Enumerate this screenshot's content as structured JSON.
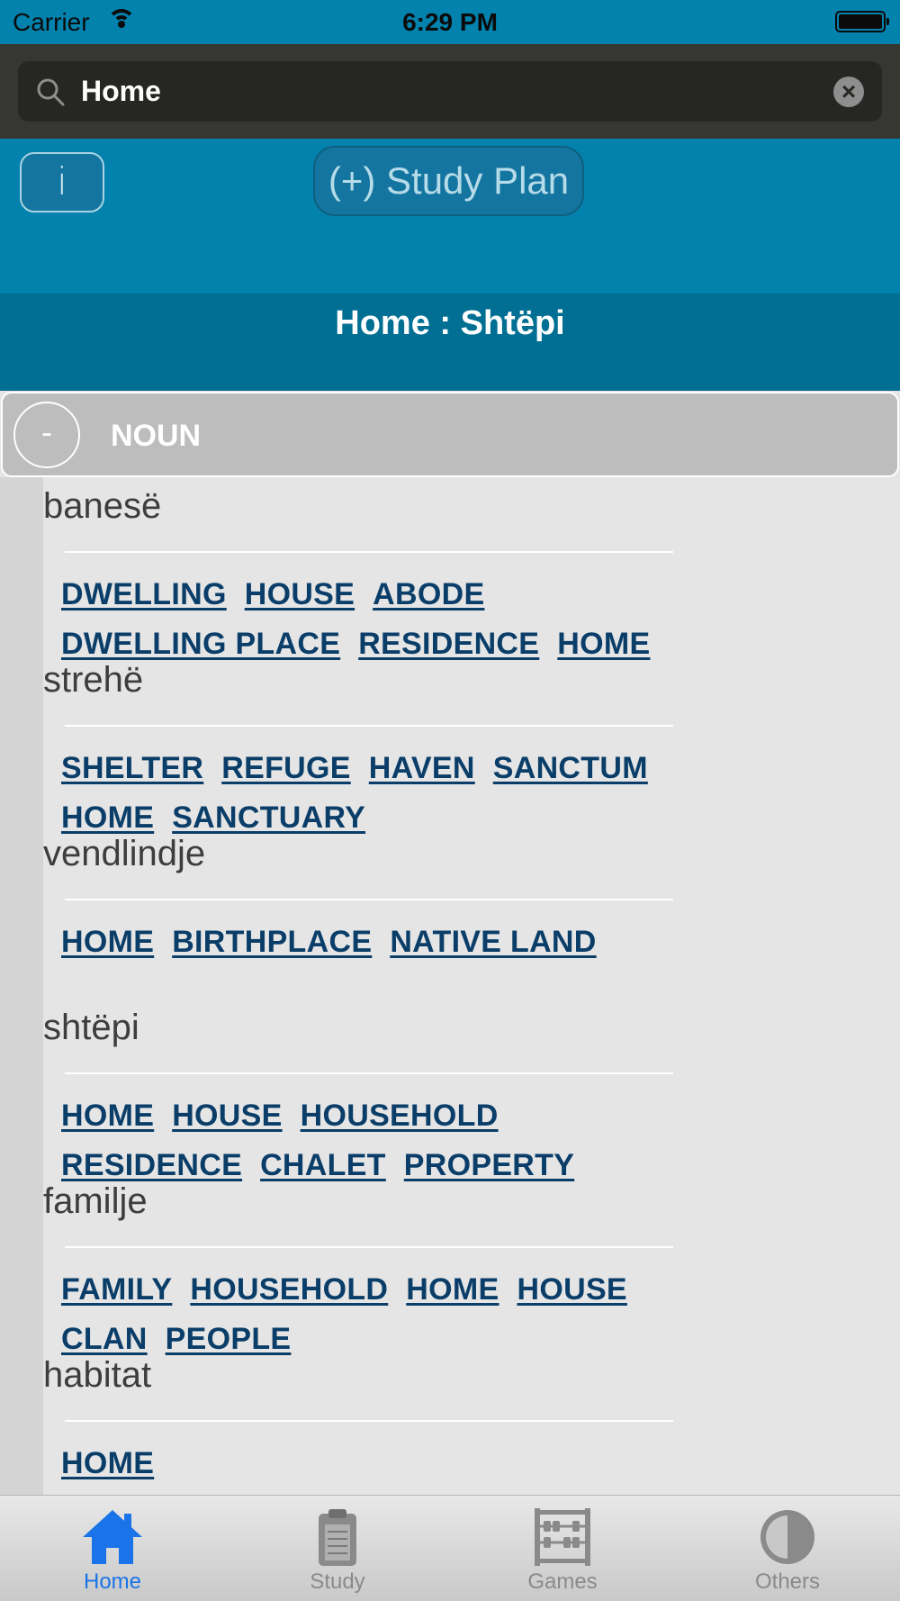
{
  "status_bar": {
    "carrier": "Carrier",
    "time": "6:29 PM"
  },
  "search": {
    "value": "Home",
    "placeholder": ""
  },
  "toolbar": {
    "info_label": "i",
    "study_plan_label": "(+) Study Plan"
  },
  "header": {
    "title": "Home : Shtëpi"
  },
  "section": {
    "toggle_label": "-",
    "label": "NOUN"
  },
  "entries": [
    {
      "word": "banesë",
      "tags": [
        "DWELLING",
        "HOUSE",
        "ABODE",
        "DWELLING PLACE",
        "RESIDENCE",
        "HOME"
      ]
    },
    {
      "word": "strehë",
      "tags": [
        "SHELTER",
        "REFUGE",
        "HAVEN",
        "SANCTUM",
        "HOME",
        "SANCTUARY"
      ]
    },
    {
      "word": "vendlindje",
      "tags": [
        "HOME",
        "BIRTHPLACE",
        "NATIVE LAND"
      ]
    },
    {
      "word": "shtëpi",
      "tags": [
        "HOME",
        "HOUSE",
        "HOUSEHOLD",
        "RESIDENCE",
        "CHALET",
        "PROPERTY"
      ]
    },
    {
      "word": "familje",
      "tags": [
        "FAMILY",
        "HOUSEHOLD",
        "HOME",
        "HOUSE",
        "CLAN",
        "PEOPLE"
      ]
    },
    {
      "word": "habitat",
      "tags": [
        "HOME"
      ]
    }
  ],
  "tabs": [
    {
      "label": "Home",
      "icon": "house-icon",
      "active": true
    },
    {
      "label": "Study",
      "icon": "clipboard-icon",
      "active": false
    },
    {
      "label": "Games",
      "icon": "abacus-icon",
      "active": false
    },
    {
      "label": "Others",
      "icon": "half-circle-icon",
      "active": false
    }
  ],
  "colors": {
    "accent": "#0282ad",
    "header": "#006f93",
    "link": "#0a3e69",
    "tab_active": "#1a73e8"
  }
}
